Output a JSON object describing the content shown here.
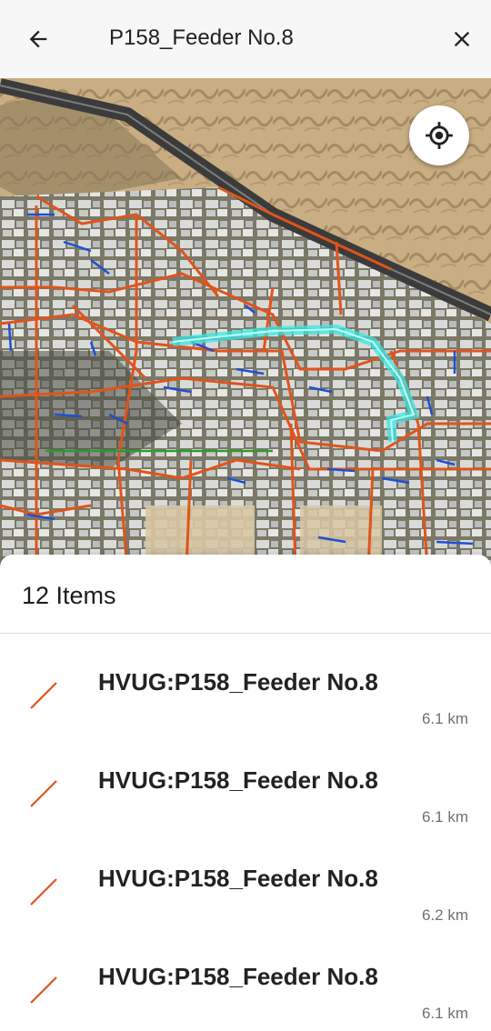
{
  "app_bar": {
    "title": "P158_Feeder No.8",
    "back_icon": "arrow-back-icon",
    "close_icon": "close-icon"
  },
  "map": {
    "locate_icon": "my-location-icon",
    "colors": {
      "feeder_line": "#e0541c",
      "service_line": "#1f4fd1",
      "selected_highlight": "#39e6e0",
      "green_line": "#2e9a2e"
    }
  },
  "results": {
    "count_label": "12 Items",
    "items": [
      {
        "name": "HVUG:P158_Feeder No.8",
        "distance": "6.1 km"
      },
      {
        "name": "HVUG:P158_Feeder No.8",
        "distance": "6.1 km"
      },
      {
        "name": "HVUG:P158_Feeder No.8",
        "distance": "6.2 km"
      },
      {
        "name": "HVUG:P158_Feeder No.8",
        "distance": "6.1 km"
      }
    ]
  }
}
